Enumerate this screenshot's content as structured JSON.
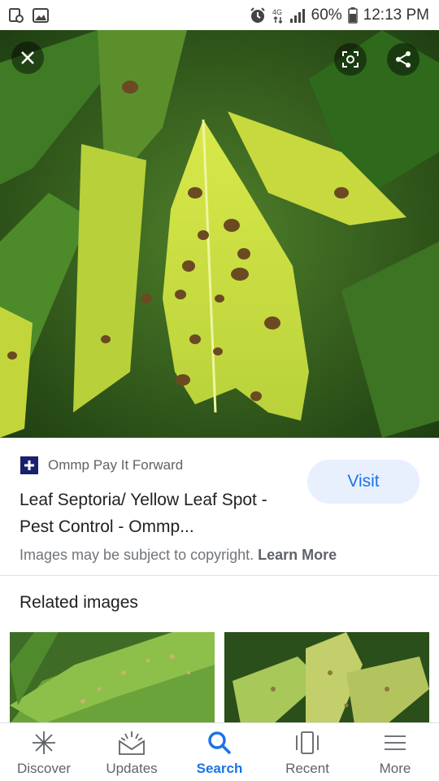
{
  "status_bar": {
    "battery": "60%",
    "time": "12:13 PM",
    "icons": [
      "screenshot-icon",
      "gallery-icon",
      "alarm-icon",
      "data-4g-icon",
      "signal-icon",
      "battery-icon"
    ]
  },
  "hero": {
    "actions": [
      "close-icon",
      "lens-icon",
      "share-icon"
    ]
  },
  "result": {
    "source": "Ommp Pay It Forward",
    "title": "Leaf Septoria/ Yellow Leaf Spot - Pest Control - Ommp...",
    "visit_label": "Visit",
    "copyright_text": "Images may be subject to copyright.",
    "learn_more": "Learn More"
  },
  "related": {
    "heading": "Related images"
  },
  "bottom_nav": {
    "items": [
      {
        "label": "Discover",
        "icon": "asterisk-icon"
      },
      {
        "label": "Updates",
        "icon": "updates-icon"
      },
      {
        "label": "Search",
        "icon": "search-icon"
      },
      {
        "label": "Recent",
        "icon": "recent-icon"
      },
      {
        "label": "More",
        "icon": "menu-icon"
      }
    ],
    "active": "Search"
  },
  "colors": {
    "accent": "#1a73e8",
    "visit_bg": "#e8f0fe",
    "favicon": "#1a1f6e"
  }
}
